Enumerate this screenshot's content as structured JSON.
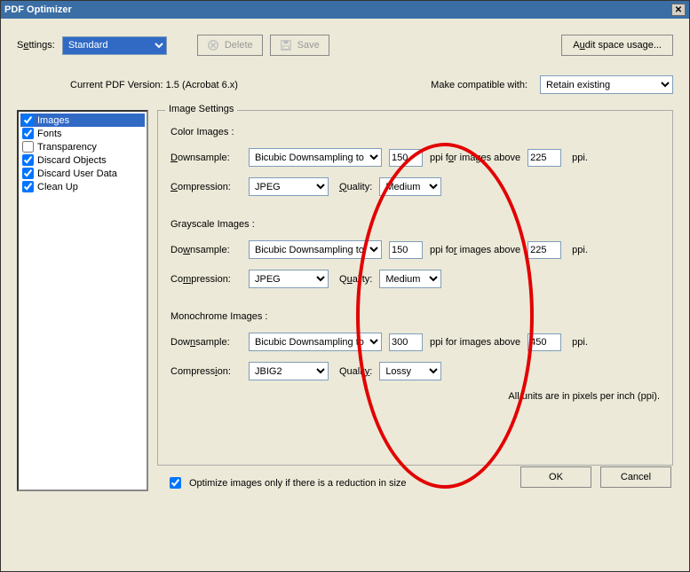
{
  "title": "PDF Optimizer",
  "labels": {
    "settings": "Settings:",
    "delete": "Delete",
    "save": "Save",
    "audit": "Audit space usage...",
    "current_version": "Current PDF Version: 1.5 (Acrobat 6.x)",
    "make_compatible": "Make compatible with:",
    "compat_value": "Retain existing",
    "ok": "OK",
    "cancel": "Cancel"
  },
  "settings_value": "Standard",
  "categories": [
    {
      "label": "Images",
      "checked": true,
      "selected": true
    },
    {
      "label": "Fonts",
      "checked": true,
      "selected": false
    },
    {
      "label": "Transparency",
      "checked": false,
      "selected": false
    },
    {
      "label": "Discard Objects",
      "checked": true,
      "selected": false
    },
    {
      "label": "Discard User Data",
      "checked": true,
      "selected": false
    },
    {
      "label": "Clean Up",
      "checked": true,
      "selected": false
    }
  ],
  "image_settings": {
    "legend": "Image Settings",
    "color": {
      "title": "Color Images :",
      "downsample_label": "Downsample:",
      "downsample_value": "Bicubic Downsampling to",
      "ppi": "150",
      "above_label": "ppi for images above",
      "above": "225",
      "unit": "ppi.",
      "compression_label": "Compression:",
      "compression_value": "JPEG",
      "quality_label": "Quality:",
      "quality_value": "Medium"
    },
    "gray": {
      "title": "Grayscale Images :",
      "downsample_label": "Downsample:",
      "downsample_value": "Bicubic Downsampling to",
      "ppi": "150",
      "above_label": "ppi for images above",
      "above": "225",
      "unit": "ppi.",
      "compression_label": "Compression:",
      "compression_value": "JPEG",
      "quality_label": "Quality:",
      "quality_value": "Medium"
    },
    "mono": {
      "title": "Monochrome Images :",
      "downsample_label": "Downsample:",
      "downsample_value": "Bicubic Downsampling to",
      "ppi": "300",
      "above_label": "ppi for images above",
      "above": "450",
      "unit": "ppi.",
      "compression_label": "Compression:",
      "compression_value": "JBIG2",
      "quality_label": "Quality:",
      "quality_value": "Lossy"
    },
    "units_note": "All units are in pixels per inch (ppi).",
    "optimize_checkbox": "Optimize images only if there is a reduction in size"
  }
}
